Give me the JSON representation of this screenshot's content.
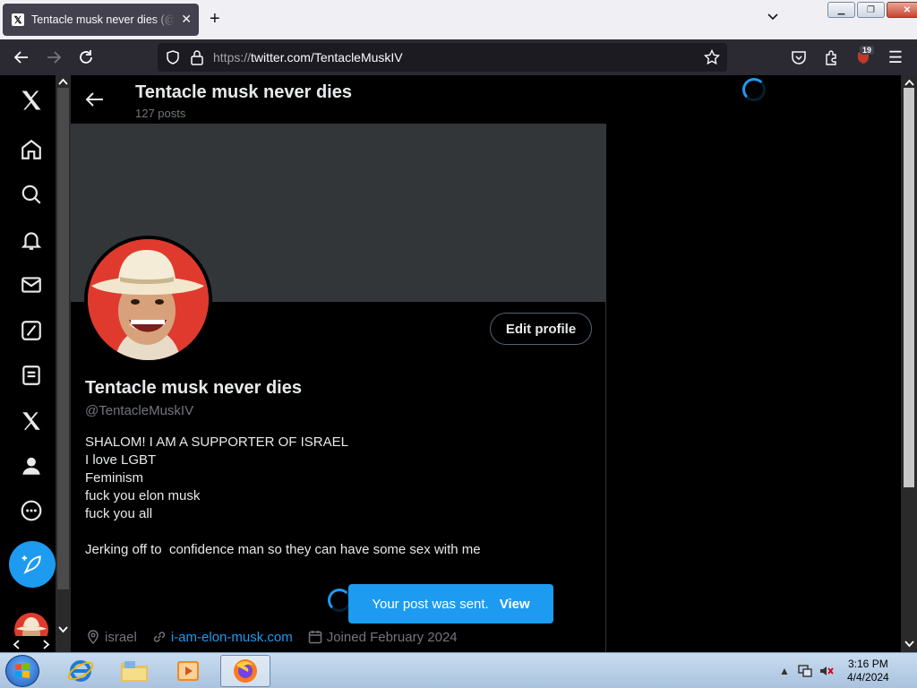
{
  "browser": {
    "tab_title": "Tentacle musk never dies (@TentacleMuskIV) / X",
    "url_protocol": "https://",
    "url_host": "twitter.com/TentacleMuskIV",
    "extension_badge": "19"
  },
  "header": {
    "title": "Tentacle musk never dies",
    "posts_count": "127 posts"
  },
  "profile": {
    "display_name": "Tentacle musk never dies",
    "handle": "@TentacleMuskIV",
    "edit_label": "Edit profile",
    "bio_lines": [
      "SHALOM! I AM A SUPPORTER OF ISRAEL",
      "I love LGBT",
      "Feminism",
      "fuck you elon musk",
      "fuck you all",
      "",
      "Jerking off to  confidence man so they can have some sex with me"
    ],
    "location": "israel",
    "website": "i-am-elon-musk.com",
    "joined": "Joined February 2024"
  },
  "toast": {
    "message": "Your post was sent.",
    "action": "View"
  },
  "taskbar": {
    "time": "3:16 PM",
    "date": "4/4/2024"
  },
  "colors": {
    "accent": "#1d9bf0",
    "text_primary": "#e7e9ea",
    "text_secondary": "#71767b",
    "banner": "#333639"
  }
}
